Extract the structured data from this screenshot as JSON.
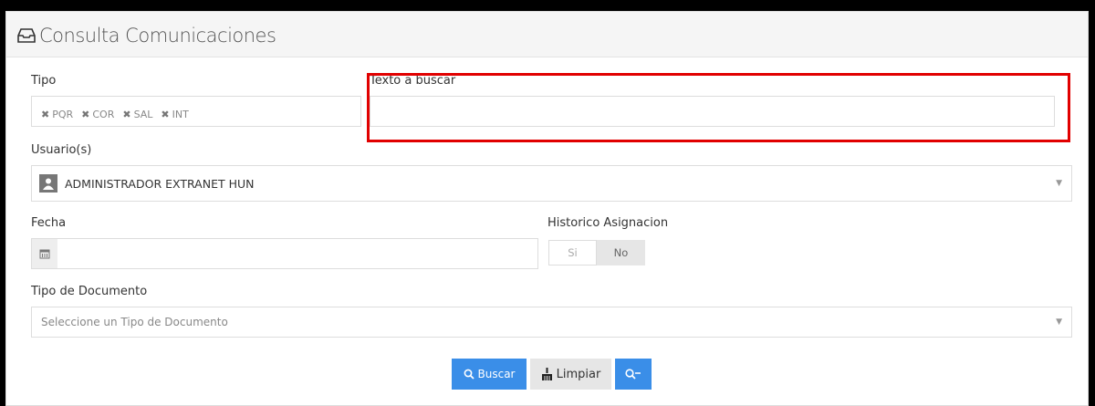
{
  "header": {
    "title": "Consulta Comunicaciones",
    "icon": "inbox-icon"
  },
  "tipo": {
    "label": "Tipo",
    "tags": [
      "PQR",
      "COR",
      "SAL",
      "INT"
    ]
  },
  "texto": {
    "label": "Texto a buscar",
    "value": ""
  },
  "usuario": {
    "label": "Usuario(s)",
    "value": "ADMINISTRADOR EXTRANET HUN"
  },
  "fecha": {
    "label": "Fecha",
    "value": ""
  },
  "historico": {
    "label": "Historico Asignacion",
    "options": [
      "Si",
      "No"
    ],
    "selected": "No"
  },
  "tipo_documento": {
    "label": "Tipo de Documento",
    "placeholder": "Seleccione un Tipo de Documento"
  },
  "buttons": {
    "buscar": "Buscar",
    "limpiar": "Limpiar"
  },
  "colors": {
    "accent": "#3a8ee8",
    "highlight": "#e10000"
  }
}
